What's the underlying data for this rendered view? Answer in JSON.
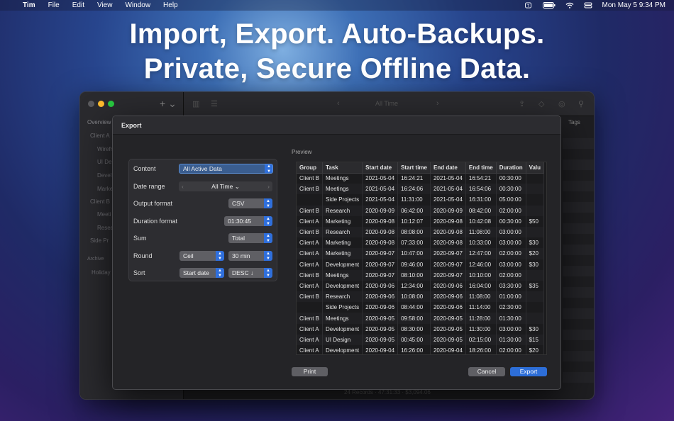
{
  "menubar": {
    "app_name": "Tim",
    "items": [
      "File",
      "Edit",
      "View",
      "Window",
      "Help"
    ],
    "clock": "Mon May 5  9:34 PM"
  },
  "headline": {
    "line1": "Import, Export.  Auto-Backups.",
    "line2": "Private, Secure Offline Data."
  },
  "app_window": {
    "sidebar": [
      "Overview",
      "Client A",
      "Wirefr",
      "UI De",
      "Devel",
      "Marke",
      "Client B",
      "Meeti",
      "Resea",
      "Side Pr",
      "Archive",
      "Holiday"
    ],
    "toolbar_title": "All Time",
    "tags_header": "Tags",
    "status": "24 Records · 47:31:33 · $3,094.06"
  },
  "dialog": {
    "title": "Export",
    "options": {
      "content": {
        "label": "Content",
        "value": "All Active Data"
      },
      "date_range": {
        "label": "Date range",
        "value": "All Time ⌄"
      },
      "output_format": {
        "label": "Output format",
        "value": "CSV"
      },
      "duration_format": {
        "label": "Duration format",
        "value": "01:30:45"
      },
      "sum": {
        "label": "Sum",
        "value": "Total"
      },
      "round": {
        "label": "Round",
        "value1": "Ceil",
        "value2": "30 min"
      },
      "sort": {
        "label": "Sort",
        "value1": "Start date",
        "value2": "DESC ↓"
      }
    },
    "preview_label": "Preview",
    "preview": {
      "columns": [
        "Group",
        "Task",
        "Start date",
        "Start time",
        "End date",
        "End time",
        "Duration",
        "Valu"
      ],
      "rows": [
        [
          "Client B",
          "Meetings",
          "2021-05-04",
          "16:24:21",
          "2021-05-04",
          "16:54:21",
          "00:30:00",
          ""
        ],
        [
          "Client B",
          "Meetings",
          "2021-05-04",
          "16:24:06",
          "2021-05-04",
          "16:54:06",
          "00:30:00",
          ""
        ],
        [
          "",
          "Side Projects",
          "2021-05-04",
          "11:31:00",
          "2021-05-04",
          "16:31:00",
          "05:00:00",
          ""
        ],
        [
          "Client B",
          "Research",
          "2020-09-09",
          "06:42:00",
          "2020-09-09",
          "08:42:00",
          "02:00:00",
          ""
        ],
        [
          "Client A",
          "Marketing",
          "2020-09-08",
          "10:12:07",
          "2020-09-08",
          "10:42:08",
          "00:30:00",
          "$50"
        ],
        [
          "Client B",
          "Research",
          "2020-09-08",
          "08:08:00",
          "2020-09-08",
          "11:08:00",
          "03:00:00",
          ""
        ],
        [
          "Client A",
          "Marketing",
          "2020-09-08",
          "07:33:00",
          "2020-09-08",
          "10:33:00",
          "03:00:00",
          "$30"
        ],
        [
          "Client A",
          "Marketing",
          "2020-09-07",
          "10:47:00",
          "2020-09-07",
          "12:47:00",
          "02:00:00",
          "$20"
        ],
        [
          "Client A",
          "Development",
          "2020-09-07",
          "09:46:00",
          "2020-09-07",
          "12:46:00",
          "03:00:00",
          "$30"
        ],
        [
          "Client B",
          "Meetings",
          "2020-09-07",
          "08:10:00",
          "2020-09-07",
          "10:10:00",
          "02:00:00",
          ""
        ],
        [
          "Client A",
          "Development",
          "2020-09-06",
          "12:34:00",
          "2020-09-06",
          "16:04:00",
          "03:30:00",
          "$35"
        ],
        [
          "Client B",
          "Research",
          "2020-09-06",
          "10:08:00",
          "2020-09-06",
          "11:08:00",
          "01:00:00",
          ""
        ],
        [
          "",
          "Side Projects",
          "2020-09-06",
          "08:44:00",
          "2020-09-06",
          "11:14:00",
          "02:30:00",
          ""
        ],
        [
          "Client B",
          "Meetings",
          "2020-09-05",
          "09:58:00",
          "2020-09-05",
          "11:28:00",
          "01:30:00",
          ""
        ],
        [
          "Client A",
          "Development",
          "2020-09-05",
          "08:30:00",
          "2020-09-05",
          "11:30:00",
          "03:00:00",
          "$30"
        ],
        [
          "Client A",
          "UI Design",
          "2020-09-05",
          "00:45:00",
          "2020-09-05",
          "02:15:00",
          "01:30:00",
          "$15"
        ],
        [
          "Client A",
          "Development",
          "2020-09-04",
          "16:26:00",
          "2020-09-04",
          "18:26:00",
          "02:00:00",
          "$20"
        ]
      ]
    },
    "buttons": {
      "print": "Print",
      "cancel": "Cancel",
      "export": "Export"
    }
  }
}
